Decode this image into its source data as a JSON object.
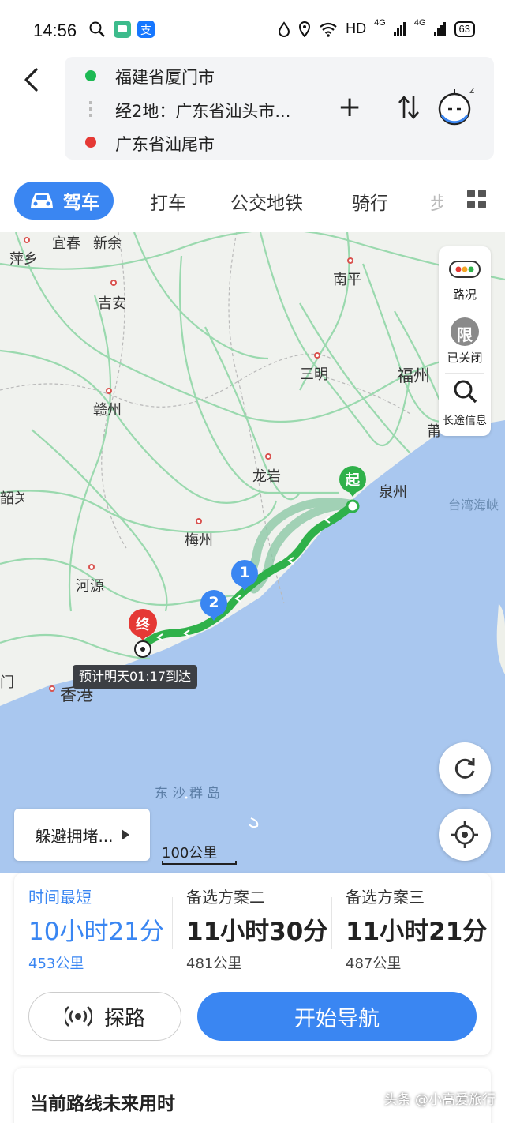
{
  "status_bar": {
    "time": "14:56",
    "network": "HD",
    "signal_1": "4G",
    "signal_2": "4G",
    "battery": "63"
  },
  "route": {
    "origin": "福建省厦门市",
    "via": "经2地：广东省汕头市...",
    "destination": "广东省汕尾市",
    "origin_color": "#1db954",
    "destination_color": "#e53935",
    "icons": [
      "back-icon",
      "add-icon",
      "swap-icon",
      "assistant-icon"
    ]
  },
  "tabs": {
    "active": "驾车",
    "items": [
      "打车",
      "公交地铁",
      "骑行",
      "步"
    ]
  },
  "map": {
    "labels": [
      "宜春",
      "新余",
      "萍乡",
      "吉安",
      "南平",
      "三明",
      "福州",
      "赣州",
      "龙岩",
      "泉州",
      "韶关",
      "梅州",
      "河源",
      "香港",
      "门",
      "莆",
      "台湾海峡",
      "东沙群岛"
    ],
    "side_panel": {
      "traffic": "路况",
      "restrict_badge": "限",
      "restrict": "已关闭",
      "long_trip": "长途信息"
    },
    "start_pin": "起",
    "end_pin": "终",
    "waypoints": [
      "1",
      "2"
    ],
    "eta": "预计明天01:17到达",
    "avoid_button": "躲避拥堵...",
    "scale": "100公里",
    "route_color": "#2fb14a",
    "sea_color": "#a9c7ef"
  },
  "options": [
    {
      "label": "时间最短",
      "time": "10小时21分",
      "distance": "453公里",
      "selected": true
    },
    {
      "label": "备选方案二",
      "time": "11小时30分",
      "distance": "481公里",
      "selected": false
    },
    {
      "label": "备选方案三",
      "time": "11小时21分",
      "distance": "487公里",
      "selected": false
    }
  ],
  "actions": {
    "probe": "探路",
    "start": "开始导航",
    "accent": "#3a86f2"
  },
  "future": {
    "title": "当前路线未来用时"
  },
  "watermark": "头条 @小高爱旅行"
}
